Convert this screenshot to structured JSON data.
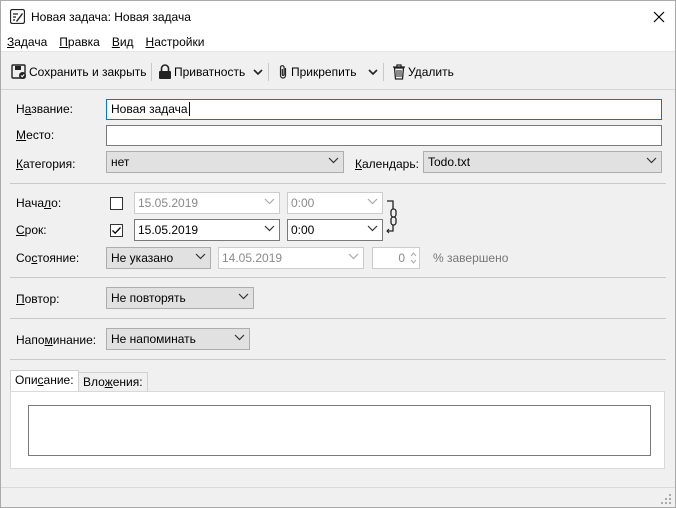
{
  "window": {
    "title": "Новая задача: Новая задача"
  },
  "menu": [
    {
      "accel": "З",
      "rest": "адача"
    },
    {
      "accel": "П",
      "rest": "равка"
    },
    {
      "accel": "В",
      "rest": "ид"
    },
    {
      "accel": "Н",
      "rest": "астройки"
    }
  ],
  "toolbar": {
    "save_close": "Сохранить и закрыть",
    "privacy": "Приватность",
    "attach": "Прикрепить",
    "delete": "Удалить"
  },
  "fields": {
    "title_label_accel": "а",
    "title_label_pre": "Н",
    "title_label_post": "звание:",
    "title_value": "Новая задача",
    "location_label_accel": "М",
    "location_label_post": "есто:",
    "location_value": "",
    "category_label_accel": "К",
    "category_label_post": "атегория:",
    "category_value": "нет",
    "calendar_label_accel": "К",
    "calendar_label_post": "алендарь:",
    "calendar_value": "Todo.txt",
    "start_label_pre": "Нача",
    "start_label_accel": "л",
    "start_label_post": "о:",
    "start_date": "15.05.2019",
    "start_time": "0:00",
    "start_checked": false,
    "due_label_accel": "С",
    "due_label_post": "рок:",
    "due_date": "15.05.2019",
    "due_time": "0:00",
    "due_checked": true,
    "status_label_pre": "Со",
    "status_label_accel": "с",
    "status_label_post": "тояние:",
    "status_value": "Не указано",
    "status_date": "14.05.2019",
    "percent_value": "0",
    "percent_suffix": "% завершено",
    "repeat_label_accel": "П",
    "repeat_label_post": "овтор:",
    "repeat_value": "Не повторять",
    "reminder_label_pre": "Напо",
    "reminder_label_accel": "м",
    "reminder_label_post": "инание:",
    "reminder_value": "Не напоминать"
  },
  "tabs": {
    "description_pre": "Опи",
    "description_accel": "с",
    "description_post": "ание:",
    "attachments_pre": "Вло",
    "attachments_accel": "ж",
    "attachments_post": "ения:"
  },
  "description_text": ""
}
